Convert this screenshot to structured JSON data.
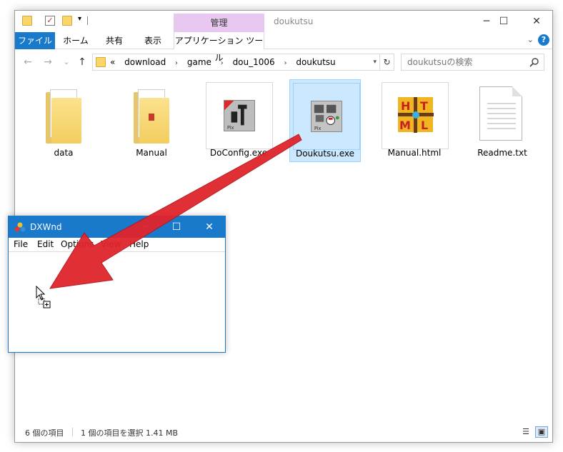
{
  "explorer": {
    "title": "doukutsu",
    "quick_access": {
      "icons": [
        "folder-icon",
        "properties-check-icon",
        "new-folder-icon"
      ],
      "dropdown": "▾"
    },
    "context_tab_header": "管理",
    "window_controls": {
      "minimize": "─",
      "maximize": "☐",
      "close": "✕"
    },
    "ribbon_tabs": [
      "ファイル",
      "ホーム",
      "共有",
      "表示"
    ],
    "context_tab": "アプリケーション ツール",
    "ribbon_collapse": "⌄",
    "help": "?",
    "nav": {
      "back": "←",
      "forward": "→",
      "recent": "⌄",
      "up": "↑"
    },
    "address": {
      "overflow": "«",
      "crumbs": [
        "download",
        "game",
        "dou_1006",
        "doukutsu"
      ],
      "separator": "›",
      "dropdown": "▾",
      "refresh": "↻"
    },
    "search_placeholder": "doukutsuの検索",
    "items": [
      {
        "label": "data",
        "kind": "folder"
      },
      {
        "label": "Manual",
        "kind": "folder-with-content"
      },
      {
        "label": "DoConfig.exe",
        "kind": "exe"
      },
      {
        "label": "Doukutsu.exe",
        "kind": "exe-selected"
      },
      {
        "label": "Manual.html",
        "kind": "html"
      },
      {
        "label": "Readme.txt",
        "kind": "text"
      }
    ],
    "status": {
      "item_count": "6 個の項目",
      "selection": "1 個の項目を選択  1.41 MB"
    },
    "view_buttons": {
      "details": "☰",
      "large_icons": "▣"
    }
  },
  "dxwnd": {
    "title": "DXWnd",
    "controls": {
      "minimize": "─",
      "maximize": "☐",
      "close": "✕"
    },
    "menu": [
      "File",
      "Edit",
      "Options",
      "View",
      "Help"
    ]
  },
  "colors": {
    "accent": "#1979ca",
    "context_tab": "#e8c8f0",
    "selection": "#cce8ff",
    "drag_arrow": "#e0242c"
  }
}
